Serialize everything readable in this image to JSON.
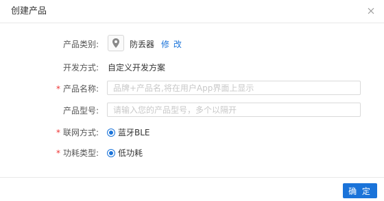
{
  "dialog": {
    "title": "创建产品",
    "close_icon": "close-icon",
    "confirm_label": "确 定",
    "accent_color": "#1a73d9",
    "required_color": "#e33333"
  },
  "form": {
    "category": {
      "label": "产品类别:",
      "icon": "location-pin-icon",
      "value": "防丢器",
      "edit_label": "修 改"
    },
    "dev_mode": {
      "label": "开发方式:",
      "value": "自定义开发方案"
    },
    "product_name": {
      "required_mark": "*",
      "label": "产品名称:",
      "value": "",
      "placeholder": "品牌+产品名,将在用户App界面上显示"
    },
    "product_model": {
      "label": "产品型号:",
      "value": "",
      "placeholder": "请输入您的产品型号，多个以隔开"
    },
    "network": {
      "required_mark": "*",
      "label": "联网方式:",
      "selected": "蓝牙BLE"
    },
    "power": {
      "required_mark": "*",
      "label": "功耗类型:",
      "selected": "低功耗"
    }
  }
}
